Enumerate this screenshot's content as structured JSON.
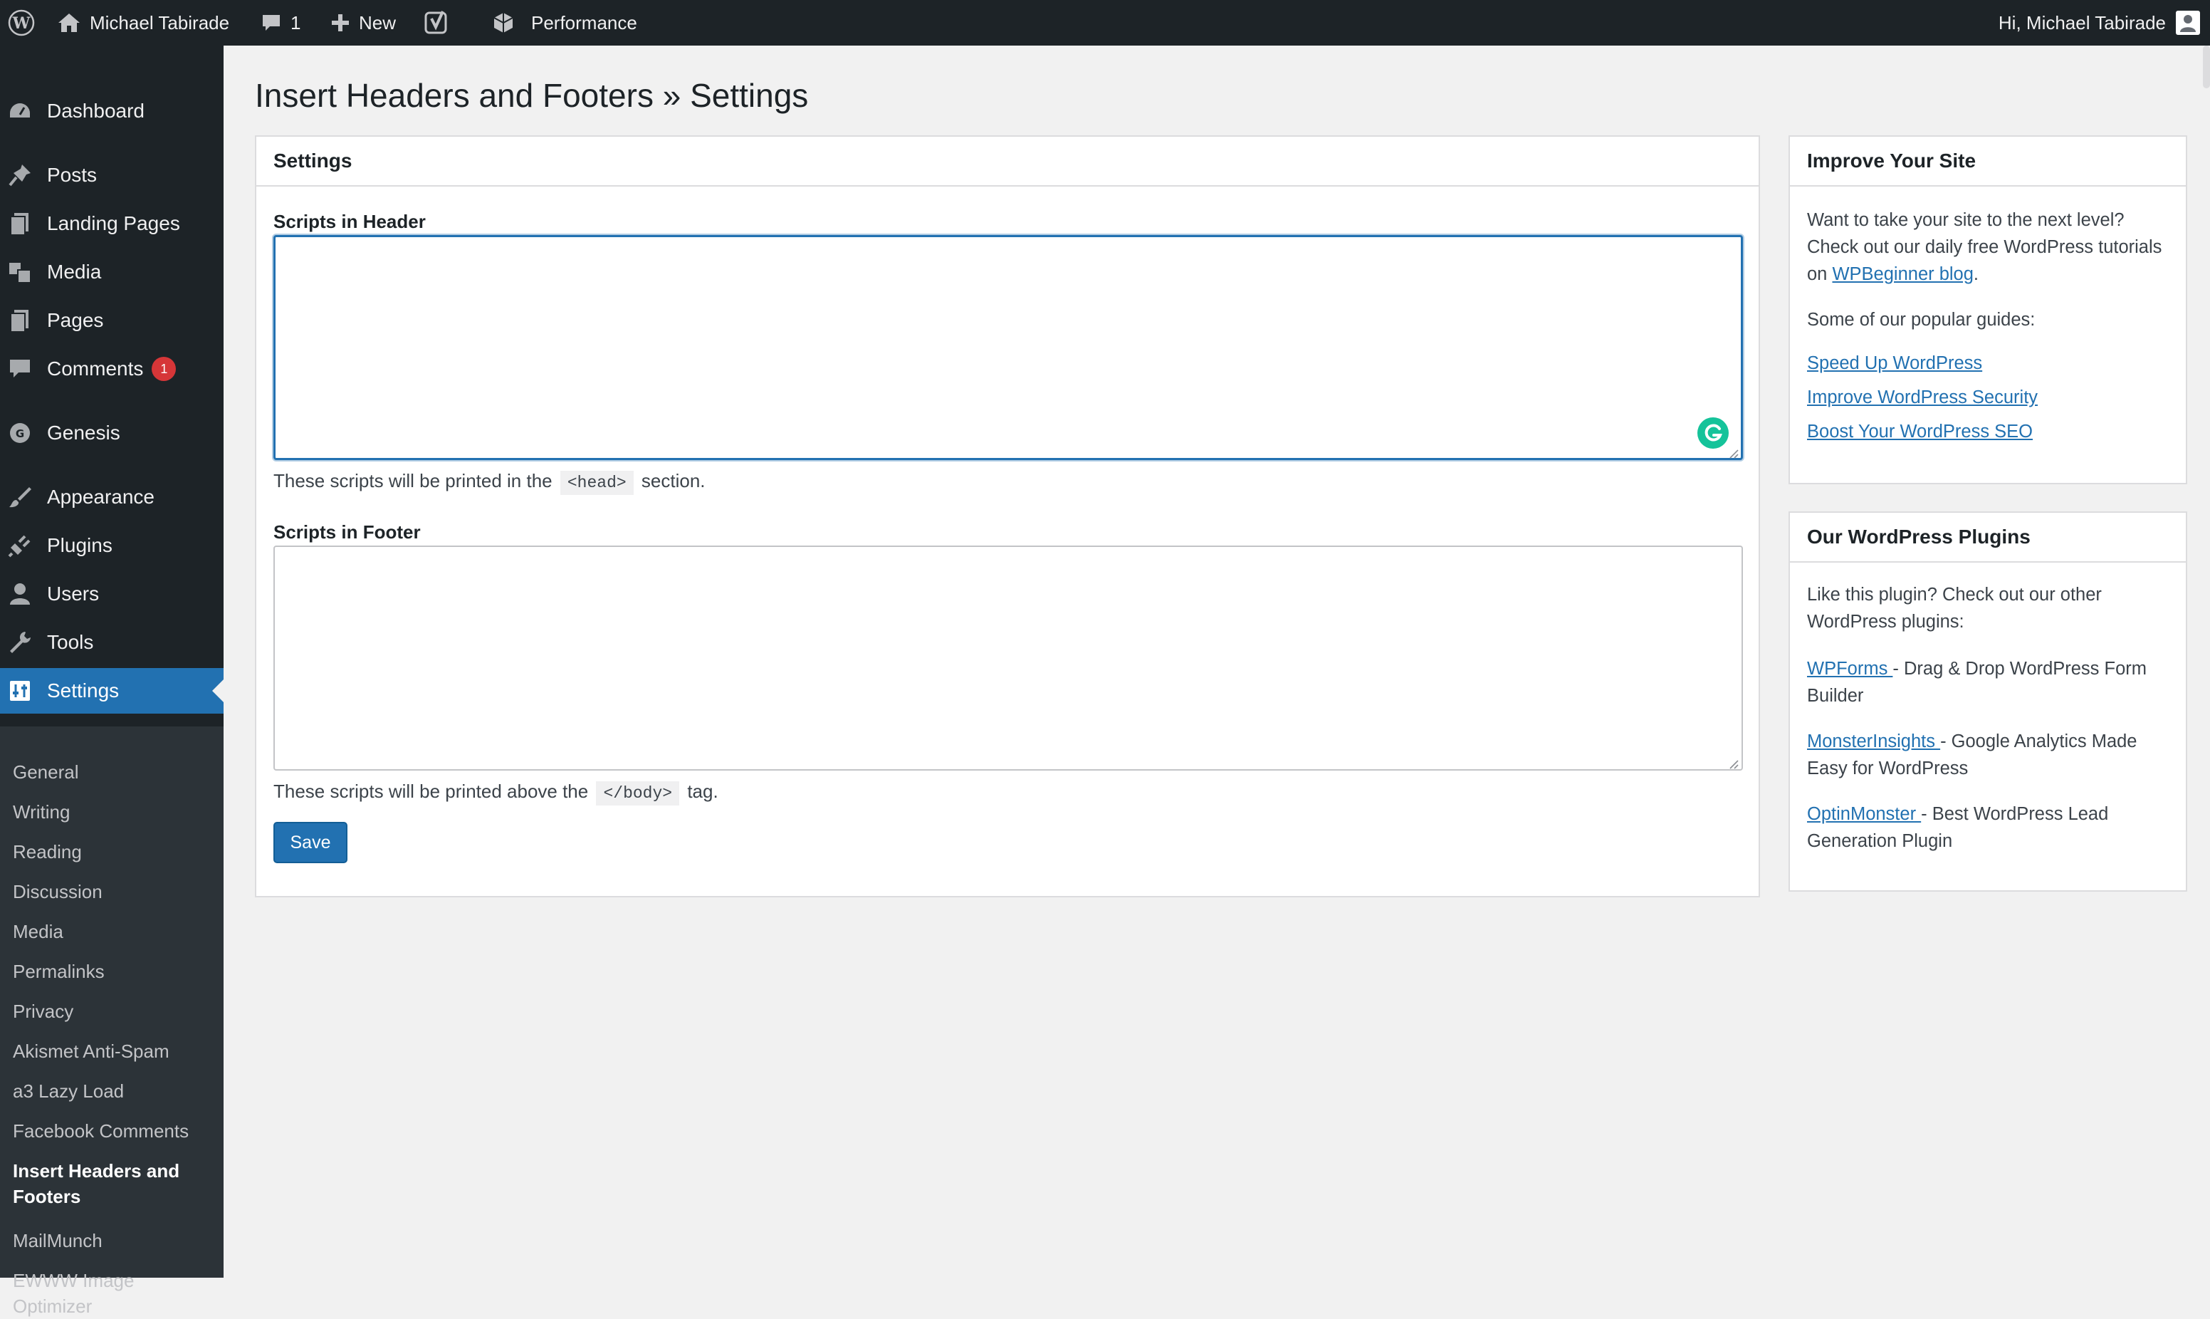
{
  "admin_bar": {
    "site_name": "Michael Tabirade",
    "comments_count": "1",
    "new_label": "New",
    "performance_label": "Performance",
    "greeting": "Hi, Michael Tabirade"
  },
  "sidebar": {
    "items": [
      {
        "label": "Dashboard",
        "icon": "dashboard-icon"
      },
      {
        "label": "Posts",
        "icon": "pin-icon"
      },
      {
        "label": "Landing Pages",
        "icon": "pages-icon"
      },
      {
        "label": "Media",
        "icon": "media-icon"
      },
      {
        "label": "Pages",
        "icon": "page-icon"
      },
      {
        "label": "Comments",
        "icon": "comment-icon",
        "badge": "1"
      },
      {
        "label": "Genesis",
        "icon": "genesis-icon"
      },
      {
        "label": "Appearance",
        "icon": "brush-icon"
      },
      {
        "label": "Plugins",
        "icon": "plug-icon"
      },
      {
        "label": "Users",
        "icon": "user-icon"
      },
      {
        "label": "Tools",
        "icon": "wrench-icon"
      },
      {
        "label": "Settings",
        "icon": "sliders-icon",
        "current": true
      }
    ],
    "submenu": [
      "General",
      "Writing",
      "Reading",
      "Discussion",
      "Media",
      "Permalinks",
      "Privacy",
      "Akismet Anti-Spam",
      "a3 Lazy Load",
      "Facebook Comments",
      "Insert Headers and Footers",
      "MailMunch",
      "EWWW Image Optimizer"
    ]
  },
  "page": {
    "title": "Insert Headers and Footers » Settings"
  },
  "settings_box": {
    "title": "Settings",
    "header_label": "Scripts in Header",
    "header_value": "",
    "header_desc_before": "These scripts will be printed in the",
    "header_desc_code": "<head>",
    "header_desc_after": "section.",
    "footer_label": "Scripts in Footer",
    "footer_value": "",
    "footer_desc_before": "These scripts will be printed above the",
    "footer_desc_code": "</body>",
    "footer_desc_after": "tag.",
    "save_label": "Save"
  },
  "improve_box": {
    "title": "Improve Your Site",
    "intro_before": "Want to take your site to the next level? Check out our daily free WordPress tutorials on",
    "intro_link": "WPBeginner blog",
    "intro_after": ".",
    "guides_label": "Some of our popular guides:",
    "links": [
      "Speed Up WordPress",
      "Improve WordPress Security",
      "Boost Your WordPress SEO"
    ]
  },
  "plugins_box": {
    "title": "Our WordPress Plugins",
    "intro": "Like this plugin? Check out our other WordPress plugins:",
    "plugins": [
      {
        "name": "WPForms ",
        "desc": "- Drag & Drop WordPress Form Builder"
      },
      {
        "name": "MonsterInsights ",
        "desc": "- Google Analytics Made Easy for WordPress"
      },
      {
        "name": "OptinMonster ",
        "desc": "- Best WordPress Lead Generation Plugin"
      }
    ]
  },
  "colors": {
    "admin_bar_bg": "#1d2327",
    "sidebar_bg": "#1d2327",
    "submenu_bg": "#2c3338",
    "accent": "#2271b1",
    "badge": "#d63638",
    "grammarly": "#15c39a"
  }
}
